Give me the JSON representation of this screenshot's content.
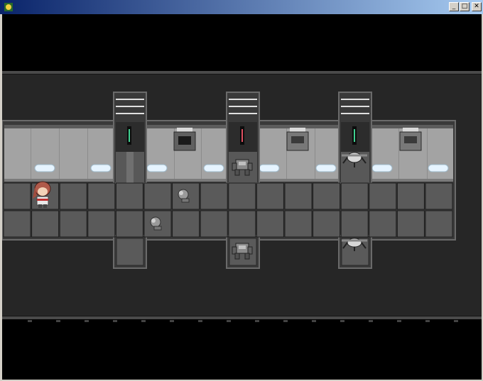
{
  "window": {
    "title": "",
    "controls": {
      "minimize": "_",
      "maximize": "□",
      "close": "✕"
    }
  },
  "scene": {
    "type": "top-down space station corridor",
    "player": {
      "name": "player-character",
      "column": 1,
      "row": 0
    },
    "robots": [
      {
        "kind": "small-drone",
        "column": 6,
        "row": 0
      },
      {
        "kind": "small-drone",
        "column": 5,
        "row": 1
      },
      {
        "kind": "walker-mech",
        "location": "door-alcove-2"
      },
      {
        "kind": "walker-mech",
        "location": "south-alcove-2"
      },
      {
        "kind": "spider-bot",
        "location": "door-alcove-3"
      },
      {
        "kind": "spider-bot",
        "location": "south-alcove-3"
      }
    ],
    "door_lights": [
      "#40d090",
      "#e05060",
      "#40d090"
    ],
    "colors": {
      "floor": "#5a5a5a",
      "wall": "#a0a0a0",
      "outer": "#262626",
      "lamp": "#e6f4ff"
    }
  }
}
